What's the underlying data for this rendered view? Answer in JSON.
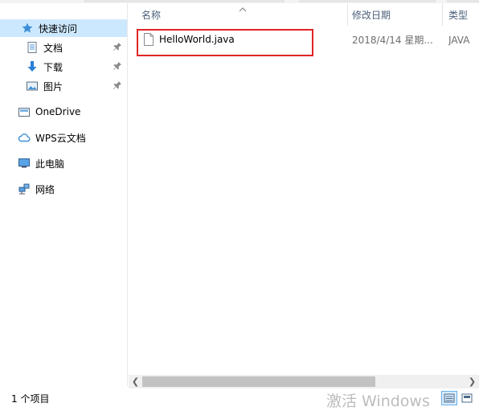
{
  "nav": {
    "quick_access": "快速访问",
    "documents": "文档",
    "downloads": "下载",
    "pictures": "图片",
    "onedrive": "OneDrive",
    "wps_cloud": "WPS云文档",
    "this_pc": "此电脑",
    "network": "网络"
  },
  "columns": {
    "name": "名称",
    "date_modified": "修改日期",
    "type": "类型"
  },
  "files": [
    {
      "name": "HelloWorld.java",
      "date_modified": "2018/4/14 星期...",
      "type": "JAVA 文"
    }
  ],
  "status": {
    "item_count": "1 个项目"
  },
  "watermark": "激活 Windows",
  "colors": {
    "selection": "#cce8ff",
    "highlight_box": "#e02525",
    "header_text": "#4c607a"
  }
}
